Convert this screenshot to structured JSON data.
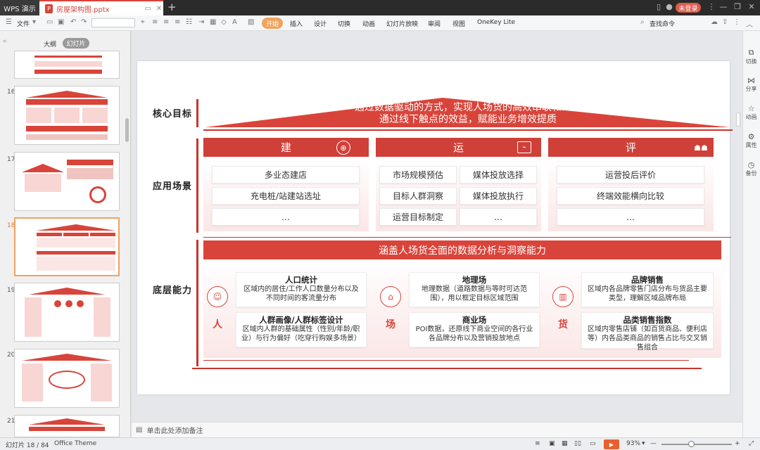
{
  "app": {
    "name": "WPS 演示"
  },
  "document": {
    "filename": "房屋架构图.pptx"
  },
  "title_bar": {
    "login_label": "未登录",
    "new_tab": "+"
  },
  "ribbon": {
    "file_menu": "文件",
    "tabs": [
      "开始",
      "插入",
      "设计",
      "切换",
      "动画",
      "幻灯片放映",
      "审阅",
      "视图",
      "OneKey Lite"
    ],
    "search_label": "查找命令"
  },
  "left_panel": {
    "outline_label": "大纲",
    "slides_label": "幻灯片",
    "slide_numbers": [
      "16",
      "17",
      "18",
      "19",
      "20",
      "21"
    ]
  },
  "slide": {
    "sections": {
      "goal": "核心目标",
      "scenarios": "应用场景",
      "capability": "底层能力"
    },
    "roof": {
      "line1": "通过数据驱动的方式，实现人场货的高效串联和匹配",
      "line2": "通过线下触点的效益，赋能业务增效提质"
    },
    "columns": [
      {
        "title": "建",
        "items": [
          "多业态建店",
          "充电桩/站建站选址",
          "…"
        ]
      },
      {
        "title": "运",
        "items": [
          "市场规模预估",
          "媒体投放选择",
          "目标人群洞察",
          "媒体投放执行",
          "运营目标制定",
          "…"
        ]
      },
      {
        "title": "评",
        "items": [
          "运营投后评价",
          "终端效能横向比较",
          "…"
        ]
      }
    ],
    "capability_banner": "涵盖人场货全面的数据分析与洞察能力",
    "capabilities": [
      {
        "char": "人",
        "boxes": [
          {
            "title": "人口统计",
            "desc": "区域内的居住/工作人口数量分布以及不同时间的客流量分布"
          },
          {
            "title": "人群画像/人群标签设计",
            "desc": "区域内人群的基础属性（性别/年龄/职业）与行为偏好（吃穿行购娱多场景）"
          }
        ]
      },
      {
        "char": "场",
        "boxes": [
          {
            "title": "地理场",
            "desc": "地理数据（道路数据与等时可达范围），用以框定目标区域范围"
          },
          {
            "title": "商业场",
            "desc": "POI数据，还原线下商业空间的各行业各品牌分布以及营销投放地点"
          }
        ]
      },
      {
        "char": "货",
        "boxes": [
          {
            "title": "品牌销售",
            "desc": "区域内各品牌零售门店分布与货品主要类型，理解区域品牌布局"
          },
          {
            "title": "品类销售指数",
            "desc": "区域内零售店铺（如百货商品、便利店等）内各品类商品的销售占比与交叉销售组合"
          }
        ]
      }
    ]
  },
  "right_panel": {
    "items": [
      "切换",
      "分享",
      "动画",
      "属性",
      "备份"
    ]
  },
  "notes": {
    "placeholder": "单击此处添加备注"
  },
  "status_bar": {
    "slide_info": "幻灯片 18 / 84",
    "theme": "Office Theme",
    "zoom": "93%"
  },
  "colors": {
    "accent": "#d9443a",
    "ribbon_active": "#f0a35e",
    "title_bar": "#2b2b2b"
  }
}
